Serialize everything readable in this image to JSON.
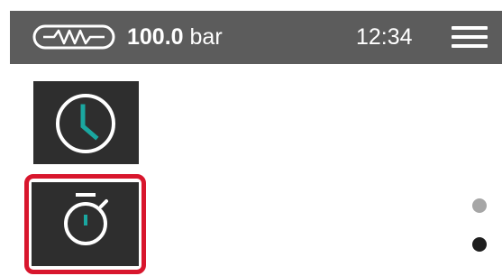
{
  "status_bar": {
    "pressure_icon": "pressure-sensor-icon",
    "pressure_value": "100.0",
    "pressure_unit": "bar",
    "time": "12:34",
    "menu_icon": "hamburger-menu-icon"
  },
  "tiles": [
    {
      "icon": "clock-icon",
      "selected": false
    },
    {
      "icon": "stopwatch-icon",
      "selected": true
    }
  ],
  "page_indicator": {
    "count": 2,
    "active_index": 1
  },
  "colors": {
    "status_bar_bg": "#5c5c5c",
    "tile_bg": "#2e2e2e",
    "accent_teal": "#1aa7a0",
    "selection_red": "#d8162d",
    "dot_inactive": "#a6a6a6",
    "dot_active": "#1e1e1e"
  }
}
